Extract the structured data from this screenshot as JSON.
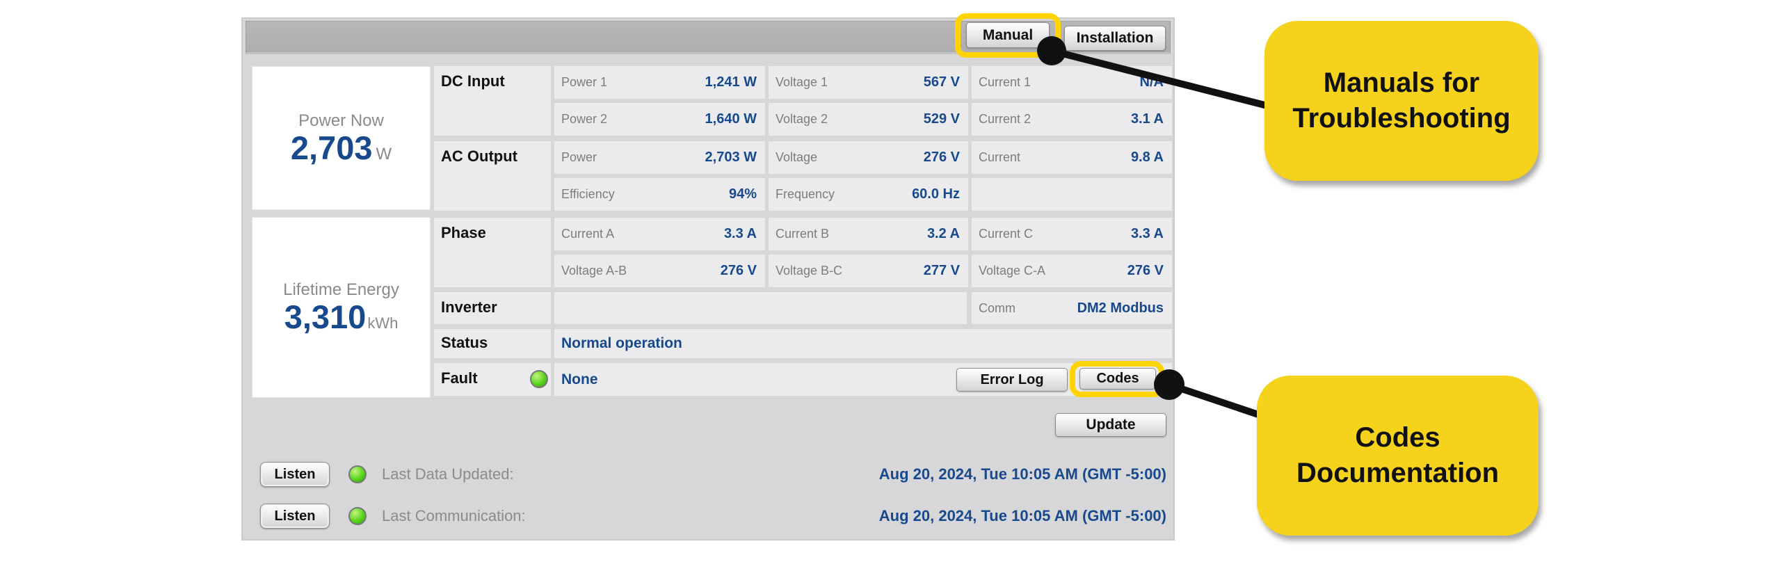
{
  "colors": {
    "value_navy": "#17498C",
    "highlight_yellow": "#FFD400",
    "callout_yellow": "#F5D21B",
    "led_green": "#54D61C",
    "panel_gray": "#d7d7d9",
    "cell_gray": "#ebebee"
  },
  "toolbar": {
    "manual": "Manual",
    "installation": "Installation"
  },
  "summary": {
    "power_now_label": "Power Now",
    "power_now_value": "2,703",
    "power_now_unit": "W",
    "lifetime_label": "Lifetime Energy",
    "lifetime_value": "3,310",
    "lifetime_unit": "kWh"
  },
  "table": {
    "labels": {
      "dc_input": "DC Input",
      "ac_output": "AC Output",
      "phase": "Phase",
      "inverter": "Inverter",
      "status": "Status",
      "fault": "Fault"
    },
    "cells": {
      "power1": {
        "k": "Power 1",
        "v": "1,241 W"
      },
      "voltage1": {
        "k": "Voltage 1",
        "v": "567 V"
      },
      "current1": {
        "k": "Current 1",
        "v": "N/A"
      },
      "power2": {
        "k": "Power 2",
        "v": "1,640 W"
      },
      "voltage2": {
        "k": "Voltage 2",
        "v": "529 V"
      },
      "current2": {
        "k": "Current 2",
        "v": "3.1 A"
      },
      "ac_power": {
        "k": "Power",
        "v": "2,703 W"
      },
      "ac_voltage": {
        "k": "Voltage",
        "v": "276 V"
      },
      "ac_current": {
        "k": "Current",
        "v": "9.8 A"
      },
      "efficiency": {
        "k": "Efficiency",
        "v": "94%"
      },
      "frequency": {
        "k": "Frequency",
        "v": "60.0 Hz"
      },
      "current_a": {
        "k": "Current A",
        "v": "3.3 A"
      },
      "current_b": {
        "k": "Current B",
        "v": "3.2 A"
      },
      "current_c": {
        "k": "Current C",
        "v": "3.3 A"
      },
      "voltage_ab": {
        "k": "Voltage A-B",
        "v": "276 V"
      },
      "voltage_bc": {
        "k": "Voltage B-C",
        "v": "277 V"
      },
      "voltage_ca": {
        "k": "Voltage C-A",
        "v": "276 V"
      },
      "comm": {
        "k": "Comm",
        "v": "DM2 Modbus"
      }
    },
    "status_value": "Normal operation",
    "fault_value": "None"
  },
  "actions": {
    "error_log": "Error Log",
    "codes": "Codes",
    "update": "Update"
  },
  "footer": {
    "listen": "Listen",
    "rows": [
      {
        "label": "Last Data Updated:",
        "value": "Aug 20, 2024, Tue 10:05 AM (GMT -5:00)"
      },
      {
        "label": "Last Communication:",
        "value": "Aug 20, 2024, Tue 10:05 AM (GMT -5:00)"
      }
    ]
  },
  "callouts": [
    {
      "line1": "Manuals for",
      "line2": "Troubleshooting"
    },
    {
      "line1": "Codes",
      "line2": "Documentation"
    }
  ]
}
